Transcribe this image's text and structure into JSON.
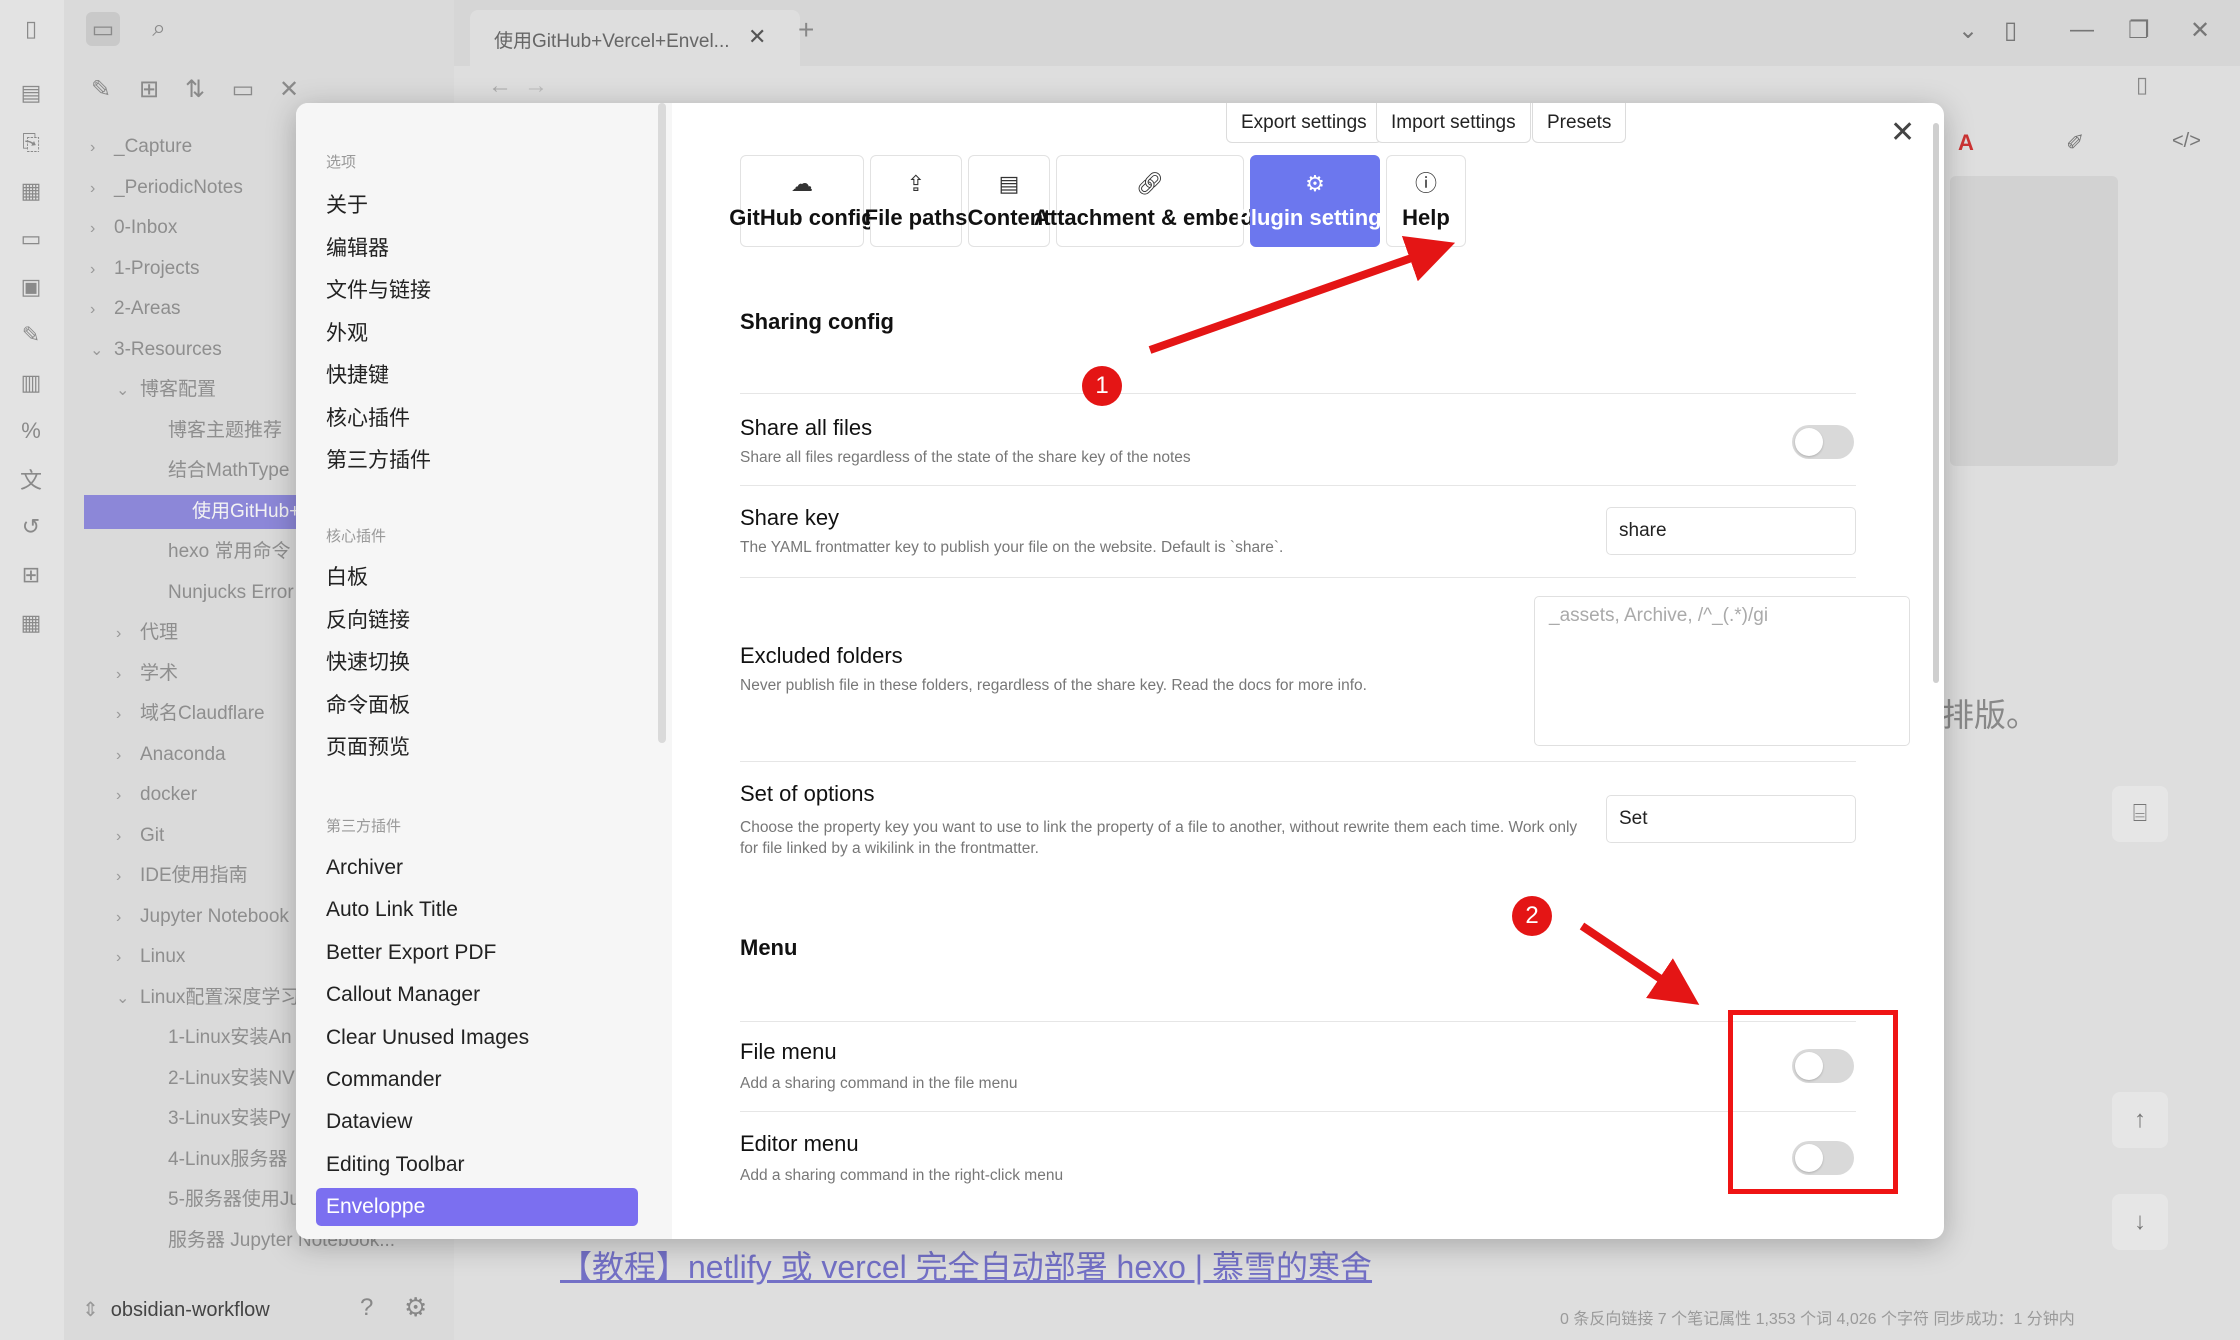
{
  "app": {
    "tab_title": "使用GitHub+Vercel+Envel...",
    "vault_name": "obsidian-workflow",
    "editor_fragment": "排版。",
    "editor_link": "【教程】netlify 或 vercel 完全自动部署 hexo | 慕雪的寒舍",
    "status_bar": "0 条反向链接   7 个笔记属性   1,353 个词  4,026 个字符   同步成功：1 分钟内"
  },
  "file_tree": [
    {
      "label": "_Capture",
      "depth": 0,
      "expanded": false
    },
    {
      "label": "_PeriodicNotes",
      "depth": 0,
      "expanded": false
    },
    {
      "label": "0-Inbox",
      "depth": 0,
      "expanded": false
    },
    {
      "label": "1-Projects",
      "depth": 0,
      "expanded": false
    },
    {
      "label": "2-Areas",
      "depth": 0,
      "expanded": false
    },
    {
      "label": "3-Resources",
      "depth": 0,
      "expanded": true
    },
    {
      "label": "博客配置",
      "depth": 1,
      "expanded": true
    },
    {
      "label": "博客主题推荐",
      "depth": 2
    },
    {
      "label": "结合MathType",
      "depth": 2
    },
    {
      "label": "使用GitHub+V",
      "depth": 2,
      "active": true
    },
    {
      "label": "hexo 常用命令",
      "depth": 2
    },
    {
      "label": "Nunjucks Error",
      "depth": 2
    },
    {
      "label": "代理",
      "depth": 1,
      "expanded": false
    },
    {
      "label": "学术",
      "depth": 1,
      "expanded": false
    },
    {
      "label": "域名Claudflare",
      "depth": 1,
      "expanded": false
    },
    {
      "label": "Anaconda",
      "depth": 1,
      "expanded": false
    },
    {
      "label": "docker",
      "depth": 1,
      "expanded": false
    },
    {
      "label": "Git",
      "depth": 1,
      "expanded": false
    },
    {
      "label": "IDE使用指南",
      "depth": 1,
      "expanded": false
    },
    {
      "label": "Jupyter Notebook",
      "depth": 1,
      "expanded": false
    },
    {
      "label": "Linux",
      "depth": 1,
      "expanded": false
    },
    {
      "label": "Linux配置深度学习",
      "depth": 1,
      "expanded": true
    },
    {
      "label": "1-Linux安装An",
      "depth": 2
    },
    {
      "label": "2-Linux安装NV",
      "depth": 2
    },
    {
      "label": "3-Linux安装Py",
      "depth": 2
    },
    {
      "label": "4-Linux服务器",
      "depth": 2
    },
    {
      "label": "5-服务器使用Ju",
      "depth": 2
    },
    {
      "label": "服务器 Jupyter Notebook...",
      "depth": 2
    }
  ],
  "settings_nav": {
    "options_header": "选项",
    "options": [
      "关于",
      "编辑器",
      "文件与链接",
      "外观",
      "快捷键",
      "核心插件",
      "第三方插件"
    ],
    "core_header": "核心插件",
    "core": [
      "白板",
      "反向链接",
      "快速切换",
      "命令面板",
      "页面预览"
    ],
    "community_header": "第三方插件",
    "community": [
      "Archiver",
      "Auto Link Title",
      "Better Export PDF",
      "Callout Manager",
      "Clear Unused Images",
      "Commander",
      "Dataview",
      "Editing Toolbar",
      "Enveloppe"
    ],
    "selected": "Enveloppe"
  },
  "plugin": {
    "top_buttons": [
      "Export settings",
      "Import settings",
      "Presets"
    ],
    "tabs": [
      {
        "label": "GitHub config",
        "icon": "cloud-icon"
      },
      {
        "label": "File paths",
        "icon": "upload-icon"
      },
      {
        "label": "Content",
        "icon": "document-icon"
      },
      {
        "label": "Attachment & embeds",
        "icon": "link-icon"
      },
      {
        "label": "Plugin settings",
        "icon": "gear-icon",
        "active": true
      },
      {
        "label": "Help",
        "icon": "info-icon"
      }
    ],
    "sharing_heading": "Sharing config",
    "share_all": {
      "name": "Share all files",
      "desc": "Share all files regardless of the state of the share key of the notes",
      "enabled": false
    },
    "share_key": {
      "name": "Share key",
      "desc": "The YAML frontmatter key to publish your file on the website. Default is `share`.",
      "value": "share"
    },
    "excluded": {
      "name": "Excluded folders",
      "desc": "Never publish file in these folders, regardless of the share key. Read the docs for more info.",
      "placeholder": "_assets, Archive, /^_(.*)/gi"
    },
    "set_options": {
      "name": "Set of options",
      "desc": "Choose the property key you want to use to link the property of a file to another, without rewrite them each time. Work only for file linked by a wikilink in the frontmatter.",
      "value": "Set"
    },
    "menu_heading": "Menu",
    "file_menu": {
      "name": "File menu",
      "desc": "Add a sharing command in the file menu",
      "enabled": false
    },
    "editor_menu": {
      "name": "Editor menu",
      "desc": "Add a sharing command in the right-click menu",
      "enabled": false
    }
  },
  "annotations": {
    "badge1": "1",
    "badge2": "2",
    "color": "#e41515"
  }
}
